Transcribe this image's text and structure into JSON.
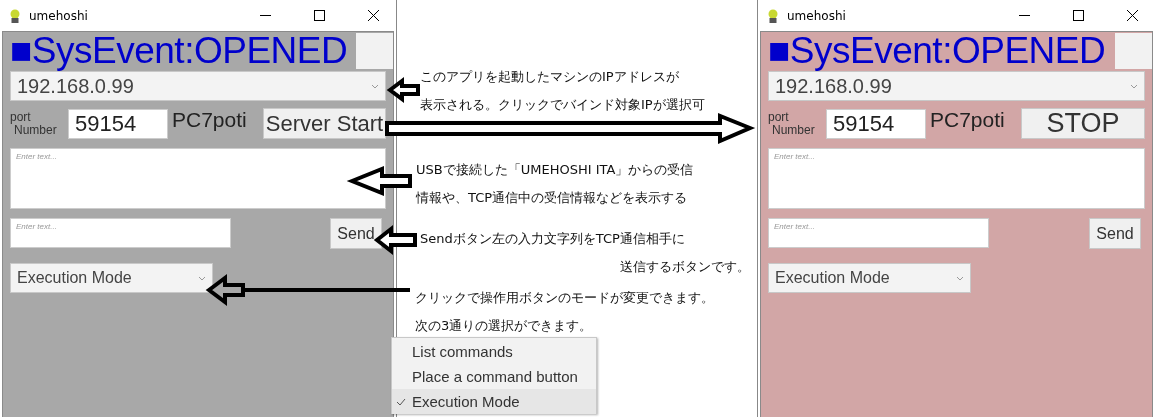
{
  "windows": [
    {
      "title": "umehoshi",
      "running": false,
      "status": "■SysEvent:OPENED",
      "ip": "192.168.0.99",
      "port_label": [
        "port",
        "Number"
      ],
      "port": "59154",
      "device": "PC7poti",
      "server_button": "Server Start",
      "log_placeholder": "Enter text...",
      "message_placeholder": "Enter text...",
      "send": "Send",
      "mode": "Execution Mode"
    },
    {
      "title": "umehoshi",
      "running": true,
      "status": "■SysEvent:OPENED",
      "ip": "192.168.0.99",
      "port_label": [
        "port",
        "Number"
      ],
      "port": "59154",
      "device": "PC7poti",
      "server_button": "STOP",
      "log_placeholder": "Enter text...",
      "message_placeholder": "Enter text...",
      "send": "Send",
      "mode": "Execution Mode"
    }
  ],
  "annotations": [
    {
      "lines": [
        "このアプリを起動したマシンのIPアドレスが",
        "表示される。クリックでバインド対象IPが選択可"
      ]
    },
    {
      "lines": [
        "USBで接続した「UMEHOSHI ITA」からの受信",
        "情報や、TCP通信中の受信情報などを表示する"
      ]
    },
    {
      "lines": [
        "Sendボタン左の入力文字列をTCP通信相手に",
        "送信するボタンです。"
      ]
    },
    {
      "lines": [
        "クリックで操作用ボタンのモードが変更できます。",
        "次の3通りの選択ができます。"
      ]
    }
  ],
  "mode_menu": {
    "items": [
      {
        "label": "List commands",
        "checked": false
      },
      {
        "label": "Place a command button",
        "checked": false
      },
      {
        "label": "Execution Mode",
        "checked": true
      }
    ]
  }
}
